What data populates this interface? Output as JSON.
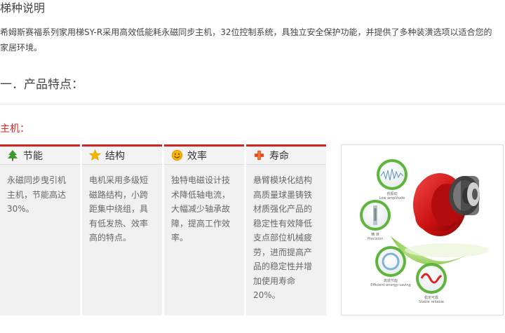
{
  "page": {
    "title": "梯种说明",
    "description": "希姆斯赛福系列家用梯SY-R采用高效低能耗永磁同步主机，32位控制系统，具独立安全保护功能，并提供了多种装潢选项以适合您的家居环境。",
    "section_heading": "一．产品特点：",
    "subheading": "主机："
  },
  "features": [
    {
      "label": "节能",
      "icon": "tree-icon",
      "text": "永磁同步曳引机主机，节能高达30%。"
    },
    {
      "label": "结构",
      "icon": "star-icon",
      "text": "电机采用多级短磁路结构，小跨距集中绕组，具有低发热、效率高的特点。"
    },
    {
      "label": "效率",
      "icon": "smiley-icon",
      "text": "独特电磁设计技术降低轴电流，大幅减少轴承故障，提高工作效率。"
    },
    {
      "label": "寿命",
      "icon": "cross-plus-icon",
      "text": "悬臂模块化结构高质量球墨铸铁材质强化产品的稳定性有效降低支点部位机械疲劳，进而提高产品的稳定性并增加使用寿命20%。"
    }
  ],
  "product_image": {
    "captions": [
      {
        "cn": "低振动",
        "en": "Low amplitude"
      },
      {
        "cn": "精 准",
        "en": "Precision"
      },
      {
        "cn": "高效节能",
        "en": "Efficient energy-saving"
      },
      {
        "cn": "稳定可靠",
        "en": "Stable reliable"
      }
    ]
  },
  "colors": {
    "accent": "#d6231f",
    "label_red": "#e8231f",
    "text": "#444444",
    "panel": "#f2f2f2"
  }
}
